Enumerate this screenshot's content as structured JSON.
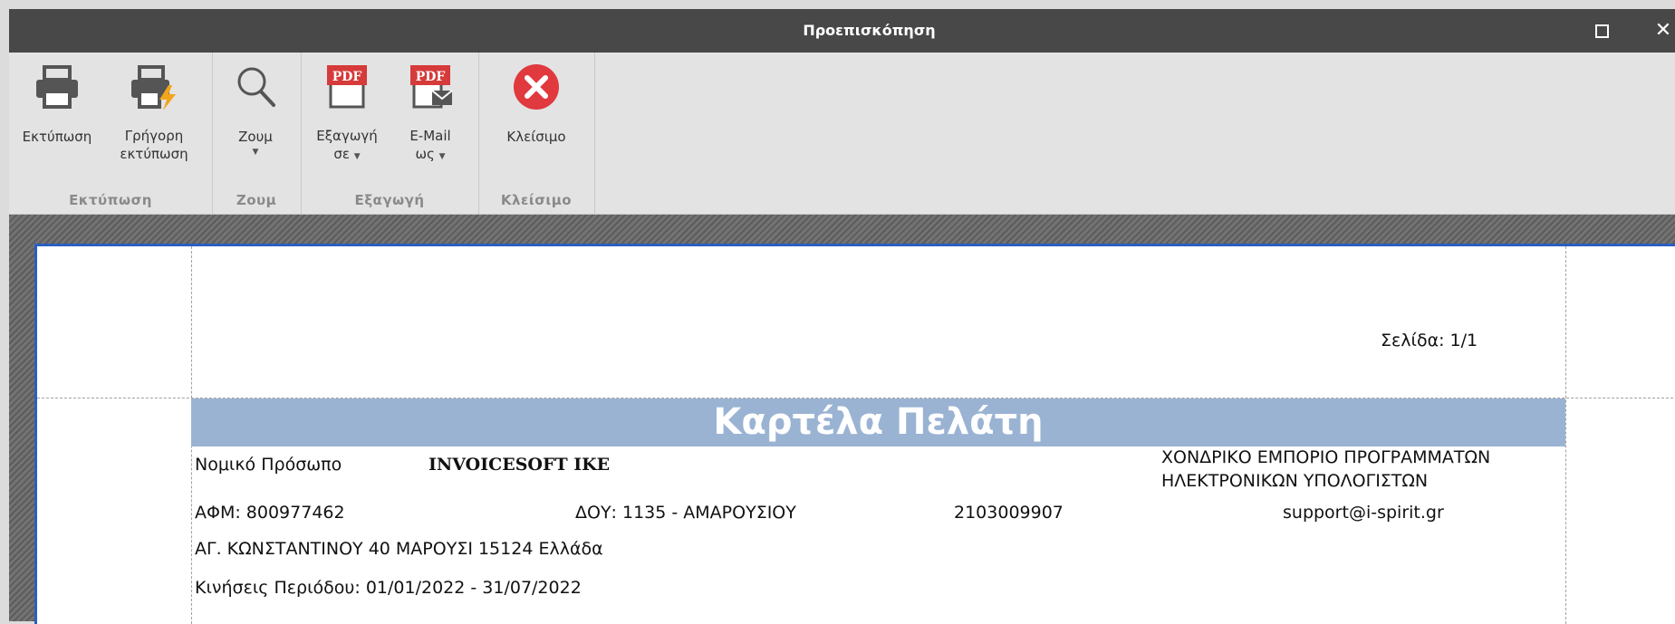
{
  "window": {
    "title": "Προεπισκόπηση",
    "maximize_label": "",
    "close_label": "✕"
  },
  "ribbon": {
    "groups": [
      {
        "label": "Εκτύπωση",
        "buttons": [
          {
            "label": "Εκτύπωση",
            "icon": "printer-icon"
          },
          {
            "label_line1": "Γρήγορη",
            "label_line2": "εκτύπωση",
            "icon": "quick-print-icon"
          }
        ]
      },
      {
        "label": "Ζουμ",
        "buttons": [
          {
            "label": "Ζουμ",
            "icon": "magnifier-icon",
            "caret": "▼"
          }
        ]
      },
      {
        "label": "Εξαγωγή",
        "buttons": [
          {
            "label_line1": "Εξαγωγή",
            "label_line2": "σε",
            "icon": "pdf-export-icon",
            "caret": "▼",
            "badge": "PDF"
          },
          {
            "label_line1": "E-Mail",
            "label_line2": "ως",
            "icon": "pdf-email-icon",
            "caret": "▼",
            "badge": "PDF"
          }
        ]
      },
      {
        "label": "Κλείσιμο",
        "buttons": [
          {
            "label": "Κλείσιμο",
            "icon": "close-circle-icon"
          }
        ]
      }
    ],
    "colors": {
      "pdf_red": "#d63a3a",
      "close_red": "#e0393e",
      "icon_gray": "#555555",
      "lightning": "#f2a51a"
    }
  },
  "document": {
    "page_label": "Σελίδα:",
    "page_value": "1/1",
    "title": "Καρτέλα Πελάτη",
    "entity_type": "Νομικό Πρόσωπο",
    "company_name": "INVOICESOFT IKE",
    "activity_line1": "ΧΟΝΔΡΙΚΟ ΕΜΠΟΡΙΟ ΠΡΟΓΡΑΜΜΑΤΩΝ",
    "activity_line2": "ΗΛΕΚΤΡΟΝΙΚΩΝ ΥΠΟΛΟΓΙΣΤΩΝ",
    "afm": "ΑΦΜ: 800977462",
    "doy": "ΔΟΥ: 1135 - ΑΜΑΡΟΥΣΙΟΥ",
    "phone": "2103009907",
    "email": "support@i-spirit.gr",
    "address": "ΑΓ. ΚΩΝΣΤΑΝΤΙΝΟΥ 40 ΜΑΡΟΥΣΙ 15124 Ελλάδα",
    "period": "Κινήσεις Περιόδου: 01/01/2022 - 31/07/2022",
    "banner_color": "#9ab3d3"
  }
}
